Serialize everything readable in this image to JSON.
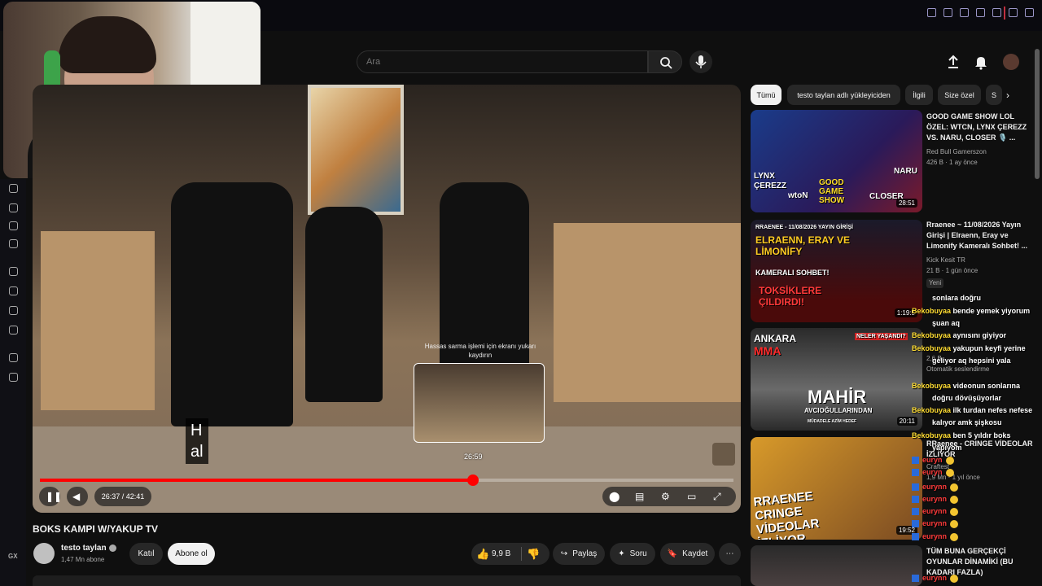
{
  "search": {
    "placeholder": "Ara"
  },
  "player": {
    "time_display": "26:37 / 42:41",
    "progress_fraction": 0.624,
    "preview_time": "26:59",
    "preview_hint": "Hassas sarma işlemi için ekranı yukarı kaydırın",
    "caption_lines": [
      "H",
      "al"
    ]
  },
  "video": {
    "title": "BOKS KAMPI W/YAKUP TV",
    "channel": "testo taylan",
    "subscribers": "1,47 Mn abone",
    "join_label": "Katıl",
    "subscribe_label": "Abone ol",
    "likes": "9,9 B",
    "share_label": "Paylaş",
    "ask_label": "Soru",
    "save_label": "Kaydet"
  },
  "chips": [
    {
      "label": "Tümü",
      "active": true
    },
    {
      "label": "testo taylan adlı yükleyiciden",
      "active": false
    },
    {
      "label": "İlgili",
      "active": false
    },
    {
      "label": "Size özel",
      "active": false
    },
    {
      "label": "S",
      "active": false
    }
  ],
  "recommendations": [
    {
      "title": "GOOD GAME SHOW LOL ÖZEL: WTCN, LYNX ÇEREZZ VS. NARU, CLOSER 🎙️ ...",
      "channel": "Red Bull Gamerszon",
      "stats": "426 B · 1 ay önce",
      "duration": "28:51",
      "badge": ""
    },
    {
      "title": "Rraenee ~ 11/08/2026 Yayın Girişi | Elraenn, Eray ve Limonify Kameralı Sohbet! ...",
      "channel": "Kick Kesit TR",
      "stats": "21 B · 1 gün önce",
      "duration": "1:19:5",
      "badge": "Yeni"
    },
    {
      "title": "",
      "channel": "",
      "stats": "2,6 B",
      "duration": "20:11",
      "badge": "Otomatik seslendirme"
    },
    {
      "title": "RRaenee - CRINGE VİDEOLAR İZLİYOR",
      "channel": "Craftest",
      "stats": "1,9 Mn · 1 yıl önce",
      "duration": "19:52",
      "badge": ""
    },
    {
      "title": "TÜM BUNA GERÇEKÇİ OYUNLAR DİNAMİKİ (BU KADARI FAZLA)",
      "channel": "",
      "stats": "",
      "duration": "",
      "badge": ""
    }
  ],
  "thumb_text": {
    "t1_lynx": "LYNX",
    "t1_cerezz": "ÇEREZZ",
    "t1_naru": "NARU",
    "t1_wton": "wtoN",
    "t1_closer": "CLOSER",
    "t1_logo": "GOOD GAME SHOW",
    "t2_top": "RRAENEE - 11/08/2026 YAYIN GİRİŞİ",
    "t2_main": "ELRAENN, ERAY VE LİMONİFY",
    "t2_sub": "KAMERALI SOHBET!",
    "t2_bottom": "TOKSİKLERE ÇILDIRDI!",
    "t3_ankara": "ANKARA",
    "t3_mma": "MMA",
    "t3_neler": "NELER YAŞANDI?",
    "t3_mahir": "MAHİR",
    "t3_sub": "AVCIOĞULLARINDAN",
    "t3_bottom": "MÜDADELE  AZİM  HEDEF",
    "t4_title": "RRAENEE CRINGE VİDEOLAR İZLİYOR"
  },
  "chat": [
    {
      "user": "",
      "text": "sonlara doğru",
      "kind": "yellow"
    },
    {
      "user": "Bekobuyaa",
      "text": "bende yemek yiyorum",
      "kind": "yellow"
    },
    {
      "user": "",
      "text": "şuan aq",
      "kind": "yellow"
    },
    {
      "user": "Bekobuyaa",
      "text": "aynısını giyiyor",
      "kind": "yellow"
    },
    {
      "user": "Bekobuyaa",
      "text": "yakupun keyfi yerine",
      "kind": "yellow"
    },
    {
      "user": "",
      "text": "geliyor aq hepsini yala",
      "kind": "yellow"
    },
    {
      "user": "Bekobuyaa",
      "text": "videonun sonlarına",
      "kind": "yellow"
    },
    {
      "user": "",
      "text": "doğru dövüşüyorlar",
      "kind": "yellow"
    },
    {
      "user": "Bekobuyaa",
      "text": "ilk turdan nefes nefese",
      "kind": "yellow"
    },
    {
      "user": "",
      "text": "kalıyor amk şişkosu",
      "kind": "yellow"
    },
    {
      "user": "Bekobuyaa",
      "text": "ben 5 yıldır boks",
      "kind": "yellow"
    },
    {
      "user": "",
      "text": "yapıyom",
      "kind": "yellow"
    },
    {
      "user": "euryn",
      "text": "",
      "kind": "red"
    },
    {
      "user": "euryn",
      "text": "",
      "kind": "red"
    },
    {
      "user": "eurynn",
      "text": "",
      "kind": "red"
    },
    {
      "user": "eurynn",
      "text": "",
      "kind": "red"
    },
    {
      "user": "eurynn",
      "text": "",
      "kind": "red"
    },
    {
      "user": "eurynn",
      "text": "",
      "kind": "red"
    },
    {
      "user": "eurynn",
      "text": "",
      "kind": "red"
    },
    {
      "user": "eurynn",
      "text": "",
      "kind": "red"
    }
  ],
  "side_rail": {
    "label": "GX"
  },
  "colors": {
    "accent": "#ff0000",
    "chat_user": "#ffdd33",
    "chat_red": "#ff3b3b"
  }
}
